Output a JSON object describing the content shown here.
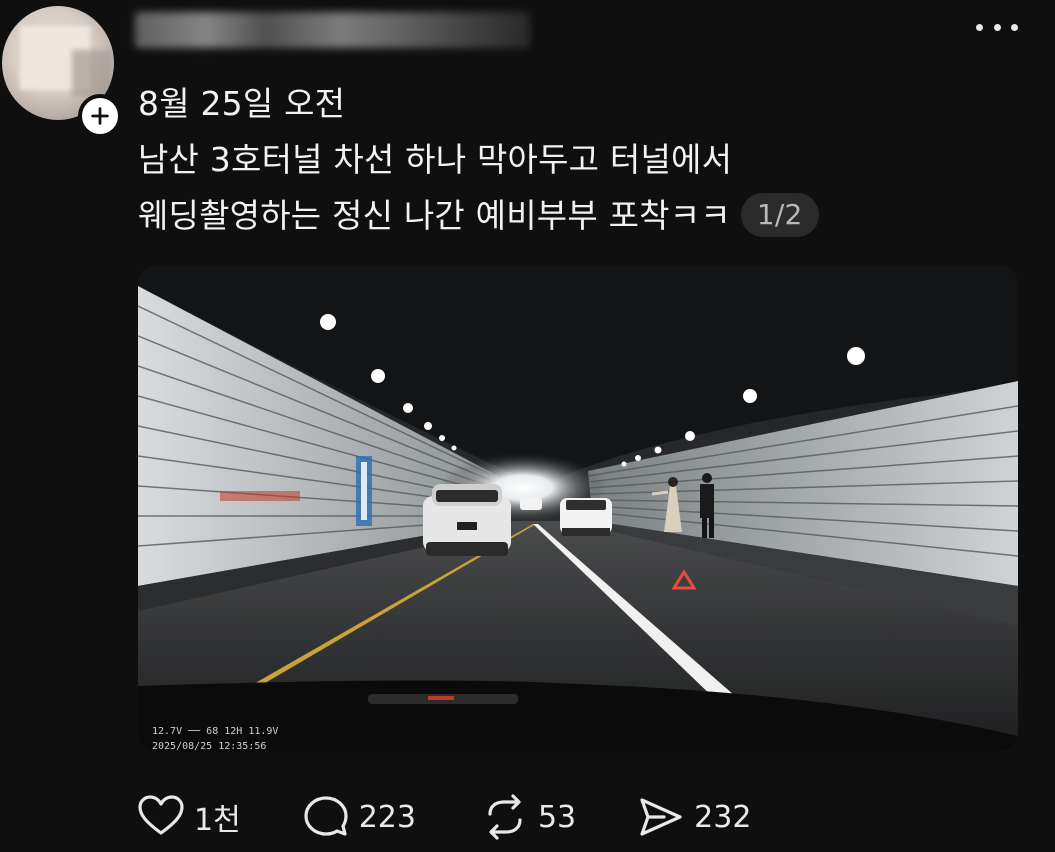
{
  "post": {
    "author_avatar": "blurred-avatar",
    "timestamp_partial": "",
    "text_lines": [
      "8월 25일 오전",
      "남산 3호터널 차선 하나 막아두고 터널에서",
      "웨딩촬영하는 정신 나간 예비부부 포착ㅋㅋ"
    ],
    "page_indicator": "1/2",
    "media": {
      "kind": "dashcam-photo",
      "overlay_line1": "12.7V ── 68   12H  11.9V",
      "overlay_line2": "2025/08/25 12:35:56"
    }
  },
  "actions": {
    "like_count": "1천",
    "reply_count": "223",
    "repost_count": "53",
    "share_count": "232"
  },
  "colors": {
    "background": "#0f0f0f",
    "text": "#f2f2f2",
    "badge_bg": "#2b2b2b"
  }
}
